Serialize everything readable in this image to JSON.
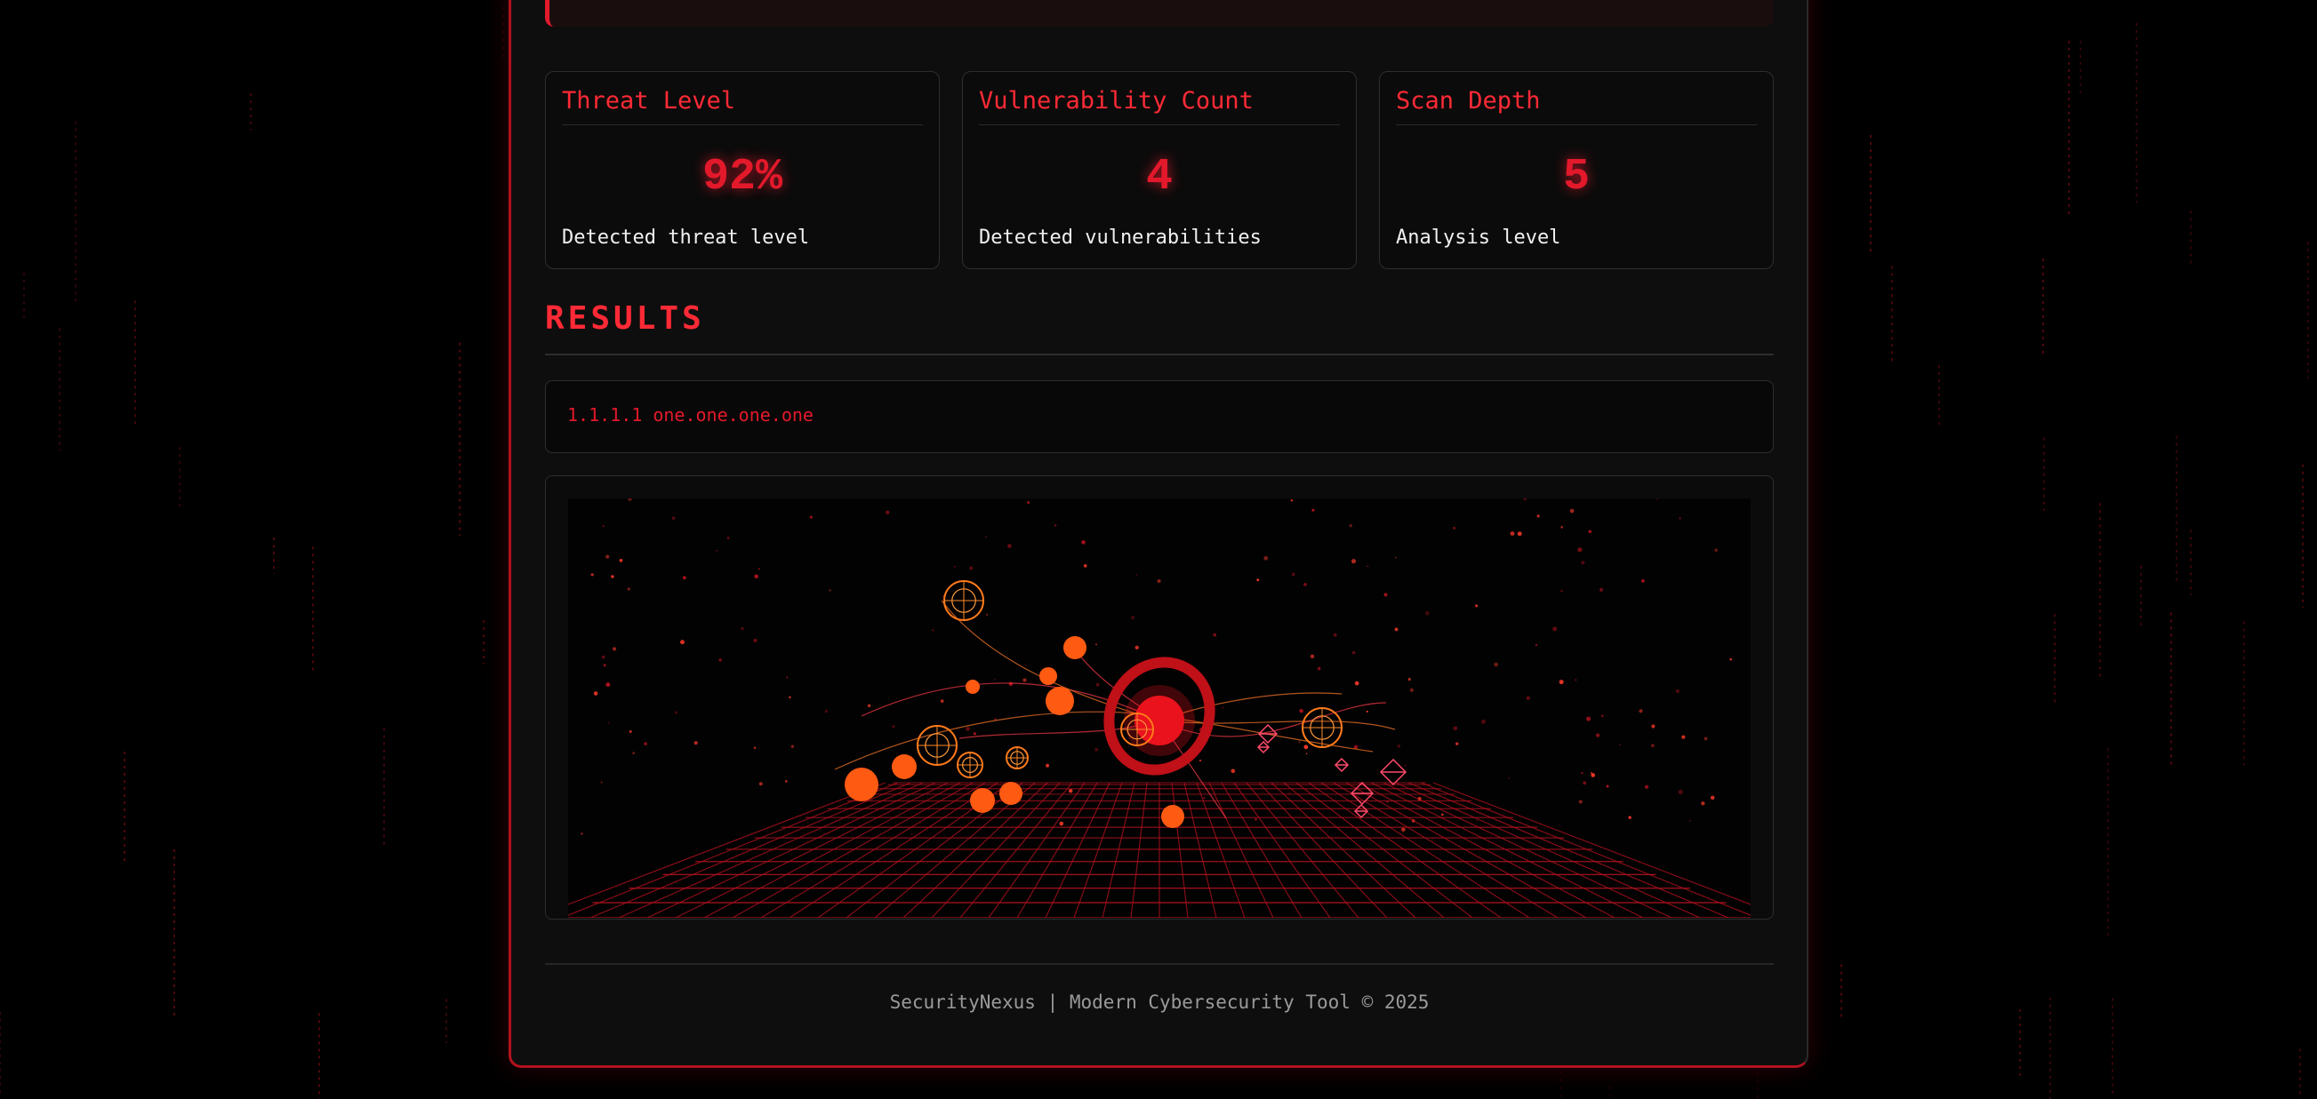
{
  "colors": {
    "accent": "#e3192b",
    "accent_orange": "#ff6a1a",
    "background": "#000000",
    "panel": "#0e0e0e",
    "text": "#f0f0f0",
    "muted": "#9a9a9a"
  },
  "metrics": [
    {
      "title": "Threat Level",
      "value": "92%",
      "description": "Detected threat level"
    },
    {
      "title": "Vulnerability Count",
      "value": "4",
      "description": "Detected vulnerabilities"
    },
    {
      "title": "Scan Depth",
      "value": "5",
      "description": "Analysis level"
    }
  ],
  "results": {
    "heading": "RESULTS",
    "output": "1.1.1.1 one.one.one.one"
  },
  "footer": {
    "text": "SecurityNexus | Modern Cybersecurity Tool © 2025"
  }
}
